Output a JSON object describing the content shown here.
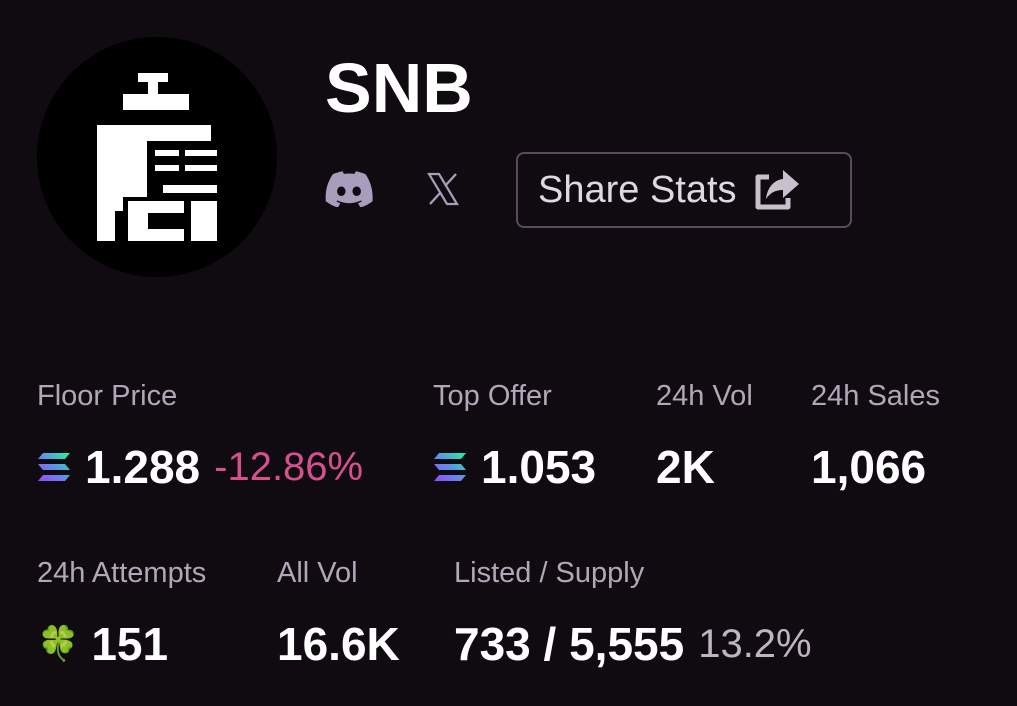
{
  "collection": {
    "name": "SNB",
    "avatar_icon": "pixel-building-logo"
  },
  "socials": {
    "discord_icon": "discord-icon",
    "x_icon": "x-icon"
  },
  "share": {
    "label": "Share Stats",
    "icon": "share-icon"
  },
  "colors": {
    "background": "#0f0b10",
    "label": "#b2a7b8",
    "value": "#ffffff",
    "negative": "#d64f8f",
    "button_border": "#574b5d",
    "social_icon": "#a89dba"
  },
  "stats": {
    "floor_price": {
      "label": "Floor Price",
      "value": "1.288",
      "change": "-12.86%",
      "currency_icon": "solana-icon"
    },
    "top_offer": {
      "label": "Top Offer",
      "value": "1.053",
      "currency_icon": "solana-icon"
    },
    "vol_24h": {
      "label": "24h Vol",
      "value": "2K"
    },
    "sales_24h": {
      "label": "24h Sales",
      "value": "1,066"
    },
    "attempts_24h": {
      "label": "24h Attempts",
      "value": "151",
      "icon": "🍀"
    },
    "all_vol": {
      "label": "All Vol",
      "value": "16.6K"
    },
    "listed_supply": {
      "label": "Listed / Supply",
      "value": "733 / 5,555",
      "percent": "13.2%"
    }
  }
}
